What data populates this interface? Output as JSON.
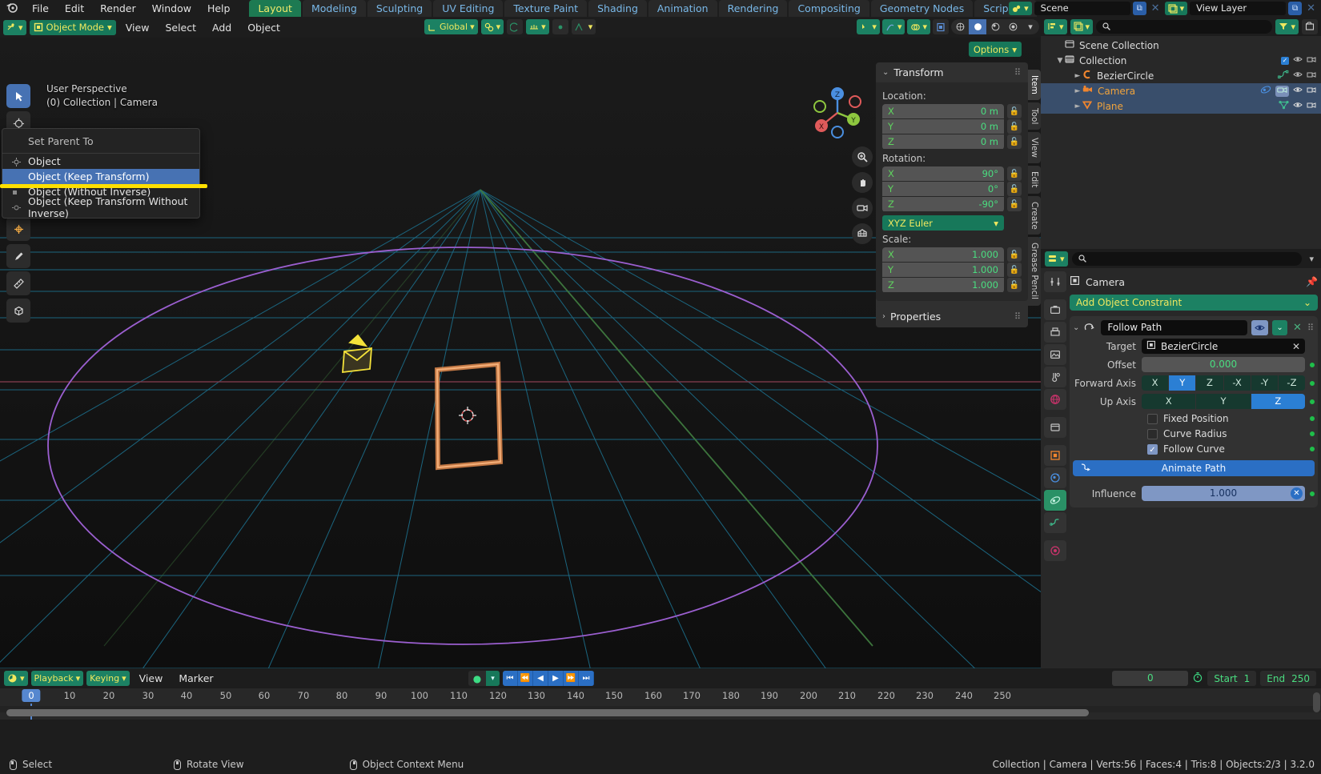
{
  "topbar": {
    "logo": "blender-logo",
    "menus": [
      "File",
      "Edit",
      "Render",
      "Window",
      "Help"
    ],
    "workspaces": [
      {
        "label": "Layout",
        "active": true
      },
      {
        "label": "Modeling",
        "active": false
      },
      {
        "label": "Sculpting",
        "active": false
      },
      {
        "label": "UV Editing",
        "active": false
      },
      {
        "label": "Texture Paint",
        "active": false
      },
      {
        "label": "Shading",
        "active": false
      },
      {
        "label": "Animation",
        "active": false
      },
      {
        "label": "Rendering",
        "active": false
      },
      {
        "label": "Compositing",
        "active": false
      },
      {
        "label": "Geometry Nodes",
        "active": false
      },
      {
        "label": "Scripting",
        "active": false
      }
    ],
    "add_workspace": "+",
    "scene_name": "Scene",
    "view_layer_name": "View Layer"
  },
  "viewport_header": {
    "mode": "Object Mode",
    "menus": [
      "View",
      "Select",
      "Add",
      "Object"
    ],
    "transform_orientation": "Global",
    "options_label": "Options"
  },
  "viewport": {
    "perspective": "User Perspective",
    "context": "(0) Collection | Camera",
    "gizmo_axes": [
      {
        "label": "Z",
        "color": "#4a8fe0"
      },
      {
        "label": "Y",
        "color": "#8ec73f"
      },
      {
        "label": "X",
        "color": "#e05a5a"
      }
    ],
    "tools": [
      "tweak-tool",
      "cursor-tool",
      "move-tool",
      "rotate-tool",
      "scale-tool",
      "transform-tool",
      "annotate-tool",
      "measure-tool",
      "add-cube-tool"
    ],
    "nav_buttons": [
      "zoom-icon",
      "pan-icon",
      "camera-view-icon",
      "toggle-ortho-icon"
    ]
  },
  "context_menu": {
    "title": "Set Parent To",
    "items": [
      {
        "label": "Object",
        "icon": "object-icon",
        "highlighted": false
      },
      {
        "label": "Object (Keep Transform)",
        "icon": "keep-transform-icon",
        "highlighted": true
      },
      {
        "label": "Object (Without Inverse)",
        "icon": "without-inverse-icon",
        "highlighted": false
      },
      {
        "label": "Object (Keep Transform Without Inverse)",
        "icon": "keep-transform-wo-inverse-icon",
        "highlighted": false
      }
    ]
  },
  "sidebar_tabs": [
    {
      "label": "Item",
      "active": true
    },
    {
      "label": "Tool",
      "active": false
    },
    {
      "label": "View",
      "active": false
    },
    {
      "label": "Edit",
      "active": false
    },
    {
      "label": "Create",
      "active": false
    },
    {
      "label": "Grease Pencil",
      "active": false
    }
  ],
  "npanel": {
    "transform_header": "Transform",
    "location_label": "Location:",
    "location": [
      {
        "axis": "X",
        "value": "0 m"
      },
      {
        "axis": "Y",
        "value": "0 m"
      },
      {
        "axis": "Z",
        "value": "0 m"
      }
    ],
    "rotation_label": "Rotation:",
    "rotation": [
      {
        "axis": "X",
        "value": "90°"
      },
      {
        "axis": "Y",
        "value": "0°"
      },
      {
        "axis": "Z",
        "value": "-90°"
      }
    ],
    "rotation_mode": "XYZ Euler",
    "scale_label": "Scale:",
    "scale": [
      {
        "axis": "X",
        "value": "1.000"
      },
      {
        "axis": "Y",
        "value": "1.000"
      },
      {
        "axis": "Z",
        "value": "1.000"
      }
    ],
    "properties_header": "Properties"
  },
  "outliner": {
    "search_placeholder": "",
    "rows": [
      {
        "label": "Scene Collection",
        "depth": 0,
        "icon": "collection-icon",
        "selected": false,
        "expand": "",
        "orange": false,
        "right": []
      },
      {
        "label": "Collection",
        "depth": 1,
        "icon": "collection-icon",
        "selected": false,
        "expand": "▼",
        "orange": false,
        "right": [
          "checkbox",
          "eye-icon",
          "camera-icon"
        ]
      },
      {
        "label": "BezierCircle",
        "depth": 2,
        "icon": "curve-icon",
        "selected": false,
        "expand": "►",
        "orange": false,
        "right": [
          "curve-data-icon",
          "eye-icon",
          "camera-icon"
        ]
      },
      {
        "label": "Camera",
        "depth": 2,
        "icon": "camera-object-icon",
        "selected": true,
        "expand": "►",
        "orange": true,
        "right": [
          "constraint-icon",
          "camera-data-icon",
          "eye-icon",
          "camera-icon"
        ]
      },
      {
        "label": "Plane",
        "depth": 2,
        "icon": "mesh-icon",
        "selected": true,
        "expand": "►",
        "orange": true,
        "right": [
          "mesh-data-icon",
          "eye-icon",
          "camera-icon"
        ]
      }
    ]
  },
  "properties": {
    "search_placeholder": "",
    "breadcrumb": "Camera",
    "add_constraint_label": "Add Object Constraint",
    "constraint": {
      "name": "Follow Path",
      "target_label": "Target",
      "target_value": "BezierCircle",
      "offset_label": "Offset",
      "offset_value": "0.000",
      "forward_axis_label": "Forward Axis",
      "forward_axis_options": [
        "X",
        "Y",
        "Z",
        "-X",
        "-Y",
        "-Z"
      ],
      "forward_axis_selected": "Y",
      "up_axis_label": "Up Axis",
      "up_axis_options": [
        "X",
        "Y",
        "Z"
      ],
      "up_axis_selected": "Z",
      "checkboxes": [
        {
          "label": "Fixed Position",
          "checked": false
        },
        {
          "label": "Curve Radius",
          "checked": false
        },
        {
          "label": "Follow Curve",
          "checked": true
        }
      ],
      "animate_path_label": "Animate Path",
      "influence_label": "Influence",
      "influence_value": "1.000"
    },
    "tabs": [
      "tool-tab",
      "render-tab",
      "output-tab",
      "view-layer-tab",
      "scene-tab",
      "world-tab",
      "collection-tab",
      "object-tab",
      "modifiers-tab",
      "constraints-tab",
      "object-data-tab",
      "material-tab"
    ]
  },
  "timeline": {
    "menus": [
      "View",
      "Marker"
    ],
    "playback_label": "Playback",
    "keying_label": "Keying",
    "current_frame": "0",
    "start_label": "Start",
    "start_value": "1",
    "end_label": "End",
    "end_value": "250",
    "ticks": [
      "0",
      "10",
      "20",
      "30",
      "40",
      "50",
      "60",
      "70",
      "80",
      "90",
      "100",
      "110",
      "120",
      "130",
      "140",
      "150",
      "160",
      "170",
      "180",
      "190",
      "200",
      "210",
      "220",
      "230",
      "240",
      "250"
    ],
    "playhead_label": "0"
  },
  "statusbar": {
    "hints": [
      {
        "icon": "mouse-left-icon",
        "label": "Select"
      },
      {
        "icon": "mouse-middle-icon",
        "label": "Rotate View"
      },
      {
        "icon": "mouse-right-icon",
        "label": "Object Context Menu"
      }
    ],
    "info": "Collection | Camera | Verts:56 | Faces:4 | Tris:8 | Objects:2/3 | 3.2.0"
  },
  "colors": {
    "accent_green": "#17785a",
    "accent_blue": "#4772b3",
    "highlight_yellow": "#ffe000",
    "select_orange": "#f0a33c"
  }
}
